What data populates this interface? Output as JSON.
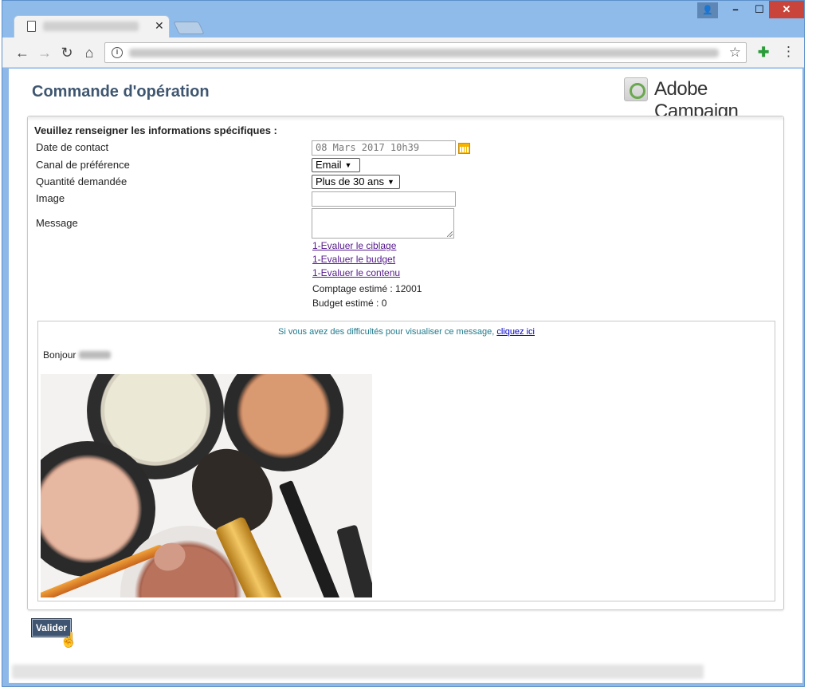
{
  "colors": {
    "title": "#3f5670",
    "link_visited": "#551a8b",
    "preview_note": "#1f7a8c",
    "button_bg": "#3f5470",
    "window_frame": "#8fbbeb"
  },
  "browser": {
    "icons": {
      "back": "arrow-left-icon",
      "forward": "arrow-right-icon",
      "reload": "reload-icon",
      "home": "home-icon",
      "info": "info-icon",
      "star": "star-icon",
      "extension": "extension-icon",
      "menu": "kebab-menu-icon"
    }
  },
  "header": {
    "title": "Commande d'opération",
    "brand": "Adobe Campaign"
  },
  "form": {
    "section_title": "Veuillez renseigner les informations spécifiques :",
    "fields": {
      "date_label": "Date de contact",
      "date_value": "08 Mars 2017 10h39",
      "canal_label": "Canal de préférence",
      "canal_value": "Email",
      "qty_label": "Quantité demandée",
      "qty_value": "Plus de 30 ans",
      "image_label": "Image",
      "image_value": "",
      "message_label": "Message",
      "message_value": ""
    },
    "links": {
      "ciblage": "1-Evaluer le ciblage",
      "budget": "1-Evaluer le budget",
      "contenu": "1-Evaluer le contenu"
    },
    "stats": {
      "count": "Comptage estimé : 12001",
      "budget": "Budget estimé : 0"
    }
  },
  "preview": {
    "note": "Si vous avez des difficultés pour visualiser ce message,",
    "note_link": "cliquez ici",
    "greeting": "Bonjour"
  },
  "actions": {
    "validate_label": "Valider"
  }
}
